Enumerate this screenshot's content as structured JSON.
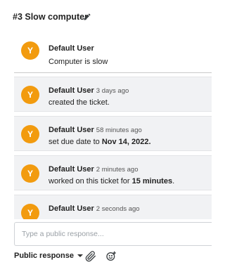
{
  "ticket": {
    "title": "#3 Slow computer"
  },
  "first_message": {
    "avatar_initial": "Y",
    "author": "Default User",
    "text": "Computer is slow"
  },
  "activity": [
    {
      "avatar_initial": "Y",
      "author": "Default User",
      "time": "3 days ago",
      "text": "created the ticket."
    },
    {
      "avatar_initial": "Y",
      "author": "Default User",
      "time": "58 minutes ago",
      "text_prefix": "set due date to ",
      "text_bold": "Nov 14, 2022."
    },
    {
      "avatar_initial": "Y",
      "author": "Default User",
      "time": "2 minutes ago",
      "text_prefix": "worked on this ticket for ",
      "text_bold": "15 minutes",
      "text_suffix": "."
    },
    {
      "avatar_initial": "Y",
      "author": "Default User",
      "time": "2 seconds ago"
    }
  ],
  "reply": {
    "placeholder": "Type a public response...",
    "mode_label": "Public response"
  },
  "colors": {
    "avatar": "#f29b0f",
    "card_background": "#f1f2f4"
  },
  "icons": [
    "pencil-icon",
    "paperclip-icon",
    "emoji-plus-icon",
    "caret-down-icon"
  ]
}
